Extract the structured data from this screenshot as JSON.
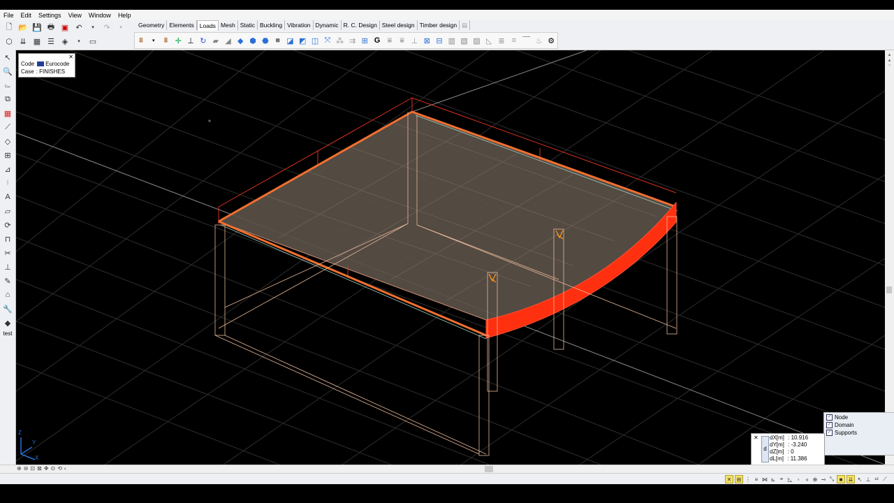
{
  "menu": [
    "File",
    "Edit",
    "Settings",
    "View",
    "Window",
    "Help"
  ],
  "tabs": [
    "Geometry",
    "Elements",
    "Loads",
    "Mesh",
    "Static",
    "Buckling",
    "Vibration",
    "Dynamic",
    "R. C. Design",
    "Steel design",
    "Timber design"
  ],
  "active_tab": "Loads",
  "info_panel": {
    "code_label": "Code",
    "code_value": "Eurocode",
    "case_label": "Case",
    "case_value": ": FINISHES"
  },
  "left_toolbar_footer": "test",
  "layers": [
    {
      "label": "Node",
      "checked": true
    },
    {
      "label": "Domain",
      "checked": true
    },
    {
      "label": "Supports",
      "checked": true
    }
  ],
  "coords": {
    "badge": "d",
    "rows": [
      {
        "label": "dX[m]",
        "value": ": 10.916"
      },
      {
        "label": "dY[m]",
        "value": ": -3.240"
      },
      {
        "label": "dZ[m]",
        "value": ": 0"
      },
      {
        "label": "dL[m]",
        "value": ": 11.386"
      }
    ]
  },
  "axis": {
    "z": "Z",
    "y": "Y",
    "x": "X"
  },
  "colors": {
    "viewport_bg": "#000000",
    "slab_fill": "#5a5048",
    "edge_load": "#ff3010",
    "wire": "#e8b898"
  }
}
